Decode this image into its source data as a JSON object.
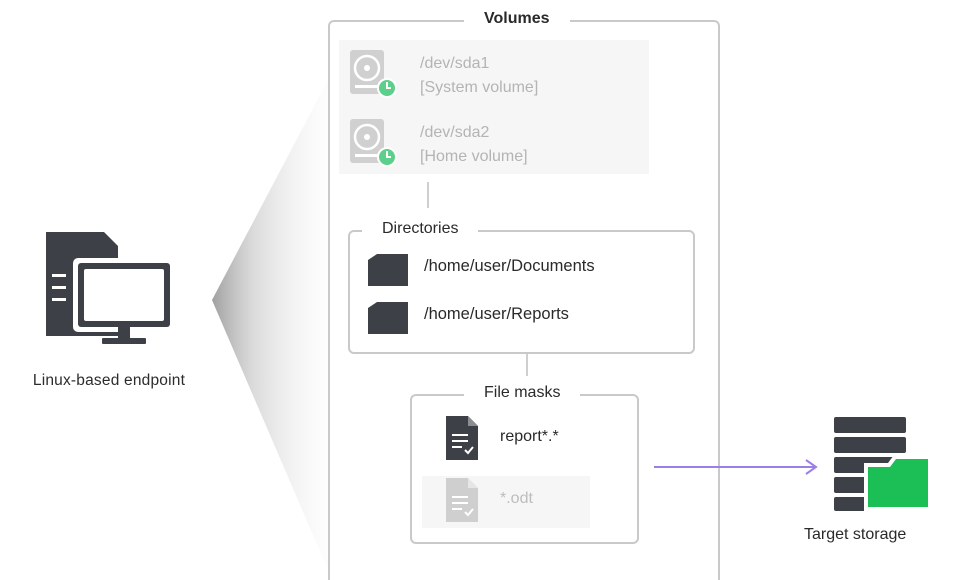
{
  "endpoint": {
    "label": "Linux-based endpoint"
  },
  "volumes": {
    "title": "Volumes",
    "items": [
      {
        "device": "/dev/sda1",
        "name": "[System volume]",
        "icon": "disk-check-icon"
      },
      {
        "device": "/dev/sda2",
        "name": "[Home volume]",
        "icon": "disk-check-icon"
      }
    ]
  },
  "directories": {
    "title": "Directories",
    "items": [
      {
        "path": "/home/user/Documents",
        "icon": "folder-icon"
      },
      {
        "path": "/home/user/Reports",
        "icon": "folder-icon"
      }
    ]
  },
  "file_masks": {
    "title": "File masks",
    "items": [
      {
        "mask": "report*.*",
        "icon": "document-icon"
      },
      {
        "mask": "*.odt",
        "icon": "document-icon"
      }
    ]
  },
  "target": {
    "label": "Target storage"
  },
  "colors": {
    "arrow": "#9b7fe6",
    "storage_folder": "#1bbf55",
    "badge": "#5ccf8a",
    "icon_dark": "#3d4147",
    "frame_border": "#c9c9c9"
  }
}
